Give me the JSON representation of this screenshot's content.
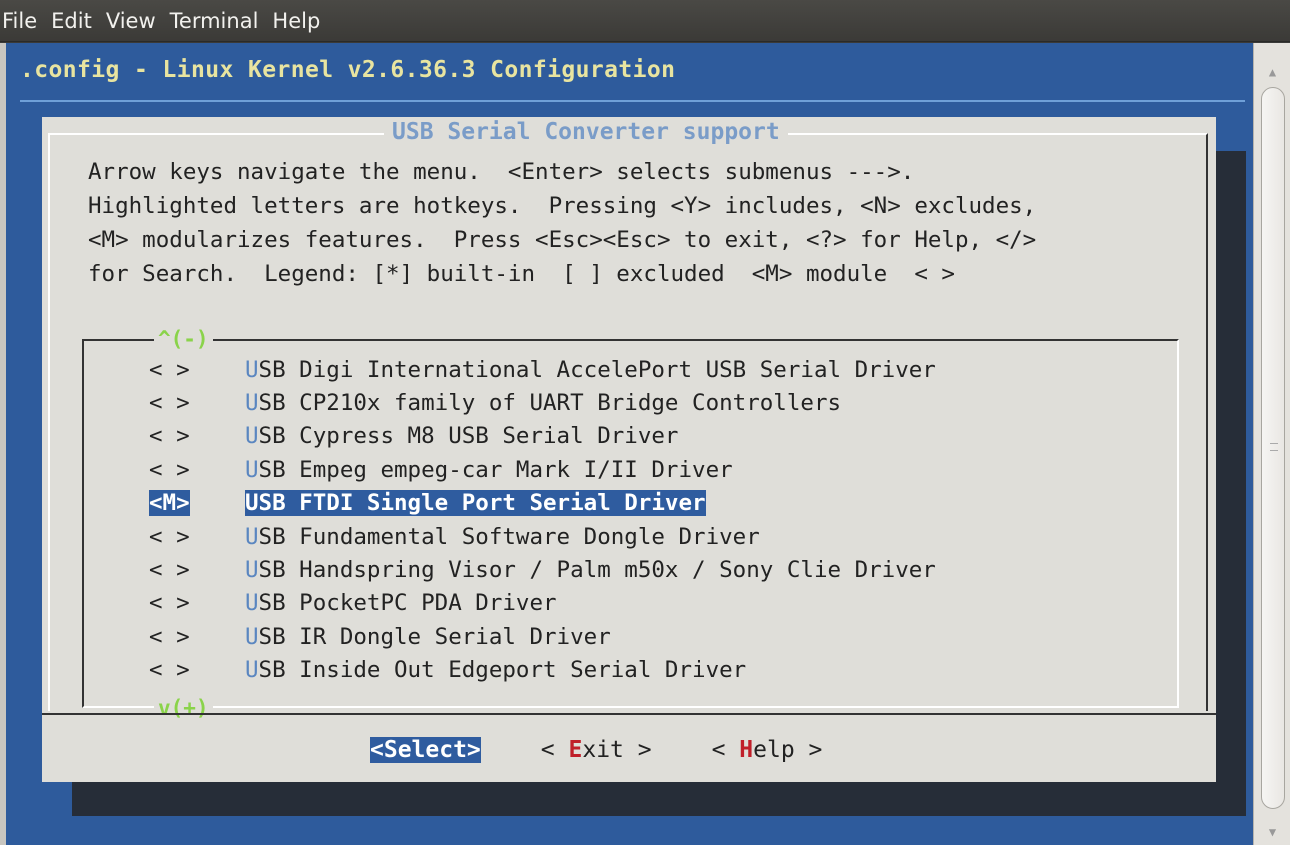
{
  "menubar": {
    "file": "File",
    "edit": "Edit",
    "view": "View",
    "terminal": "Terminal",
    "help": "Help"
  },
  "terminal": {
    "title": ".config - Linux Kernel v2.6.36.3 Configuration"
  },
  "dialog": {
    "title": "USB Serial Converter support",
    "instructions": "Arrow keys navigate the menu.  <Enter> selects submenus --->.\nHighlighted letters are hotkeys.  Pressing <Y> includes, <N> excludes,\n<M> modularizes features.  Press <Esc><Esc> to exit, <?> for Help, </>\nfor Search.  Legend: [*] built-in  [ ] excluded  <M> module  < >",
    "scroll_up": "^(-)",
    "scroll_down": "v(+)",
    "items": [
      {
        "mark": "< >",
        "hot": "U",
        "rest": "SB Digi International AccelePort USB Serial Driver"
      },
      {
        "mark": "< >",
        "hot": "U",
        "rest": "SB CP210x family of UART Bridge Controllers"
      },
      {
        "mark": "< >",
        "hot": "U",
        "rest": "SB Cypress M8 USB Serial Driver"
      },
      {
        "mark": "< >",
        "hot": "U",
        "rest": "SB Empeg empeg-car Mark I/II Driver"
      },
      {
        "mark": "<M>",
        "hot": "U",
        "rest": "SB FTDI Single Port Serial Driver",
        "selected": true
      },
      {
        "mark": "< >",
        "hot": "U",
        "rest": "SB Fundamental Software Dongle Driver"
      },
      {
        "mark": "< >",
        "hot": "U",
        "rest": "SB Handspring Visor / Palm m50x / Sony Clie Driver"
      },
      {
        "mark": "< >",
        "hot": "U",
        "rest": "SB PocketPC PDA Driver"
      },
      {
        "mark": "< >",
        "hot": "U",
        "rest": "SB IR Dongle Serial Driver"
      },
      {
        "mark": "< >",
        "hot": "U",
        "rest": "SB Inside Out Edgeport Serial Driver"
      }
    ],
    "buttons": {
      "select": "<Select>",
      "exit_pre": "< ",
      "exit_hot": "E",
      "exit_post": "xit >",
      "help_pre": "< ",
      "help_hot": "H",
      "help_post": "elp >"
    }
  },
  "icons": {
    "scroll_up": "triangle-up-icon",
    "scroll_down": "triangle-down-icon"
  }
}
